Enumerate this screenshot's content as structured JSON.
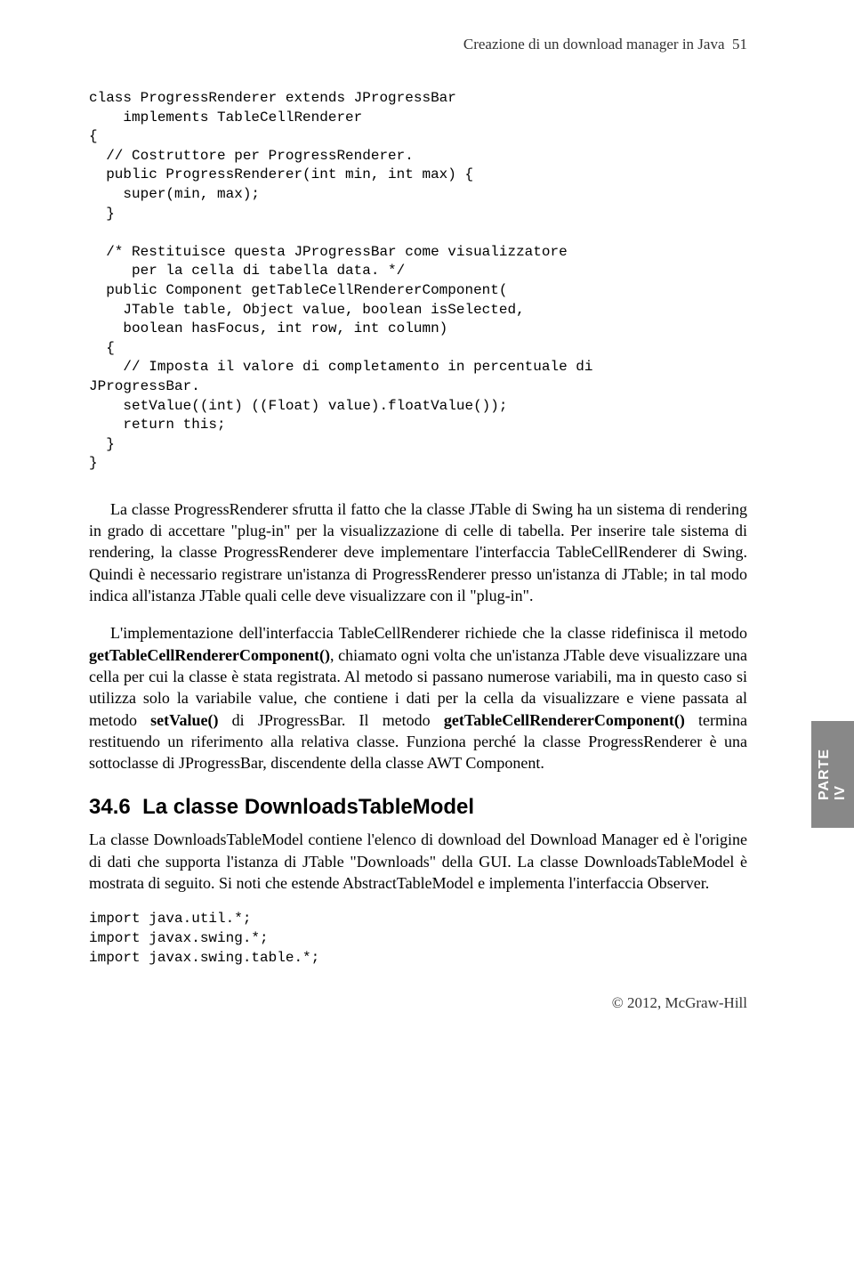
{
  "header": {
    "running_title": "Creazione di un download manager in Java",
    "page_number": "51"
  },
  "code": {
    "block1": "class ProgressRenderer extends JProgressBar\n    implements TableCellRenderer\n{\n  // Costruttore per ProgressRenderer.\n  public ProgressRenderer(int min, int max) {\n    super(min, max);\n  }\n\n  /* Restituisce questa JProgressBar come visualizzatore\n     per la cella di tabella data. */\n  public Component getTableCellRendererComponent(\n    JTable table, Object value, boolean isSelected,\n    boolean hasFocus, int row, int column)\n  {\n    // Imposta il valore di completamento in percentuale di\nJProgressBar.\n    setValue((int) ((Float) value).floatValue());\n    return this;\n  }\n}",
    "block2": "import java.util.*;\nimport javax.swing.*;\nimport javax.swing.table.*;"
  },
  "paragraphs": {
    "p1_a": "La classe ProgressRenderer sfrutta il fatto che la classe JTable di Swing ha un sistema di rendering in grado di accettare \"plug-in\" per la visualizzazione di celle di tabella. Per inserire tale sistema di rendering, la classe ProgressRenderer deve implementare l'interfaccia TableCellRenderer di Swing. Quindi è necessario registrare un'istanza di ProgressRenderer presso un'istanza di JTable; in tal modo indica all'istanza JTable quali celle deve visualizzare con il \"plug-in\".",
    "p2_a": "L'implementazione dell'interfaccia TableCellRenderer richiede che la classe ridefinisca il metodo ",
    "p2_b1": "getTableCellRendererComponent()",
    "p2_c": ", chiamato ogni volta che un'istanza JTable deve visualizzare una cella per cui la classe è stata registrata. Al metodo si passano numerose variabili, ma in questo caso si utilizza solo la variabile value, che contiene i dati per la cella da visualizzare e viene passata al metodo ",
    "p2_b2": "setValue()",
    "p2_d": " di JProgressBar. Il metodo ",
    "p2_b3": "getTableCellRendererComponent()",
    "p2_e": " termina restituendo un riferimento alla relativa classe. Funziona perché la classe ProgressRenderer è una sottoclasse di JProgressBar, discendente della classe AWT Component.",
    "p3": "La classe DownloadsTableModel contiene l'elenco di download del Download Manager ed è l'origine di dati che supporta l'istanza di JTable \"Downloads\" della GUI. La classe DownloadsTableModel è mostrata di seguito. Si noti che estende AbstractTableModel e implementa l'interfaccia Observer."
  },
  "section": {
    "number": "34.6",
    "title": "La classe DownloadsTableModel"
  },
  "sidebar": {
    "label": "PARTE IV"
  },
  "footer": {
    "copyright": "© 2012, McGraw-Hill"
  }
}
